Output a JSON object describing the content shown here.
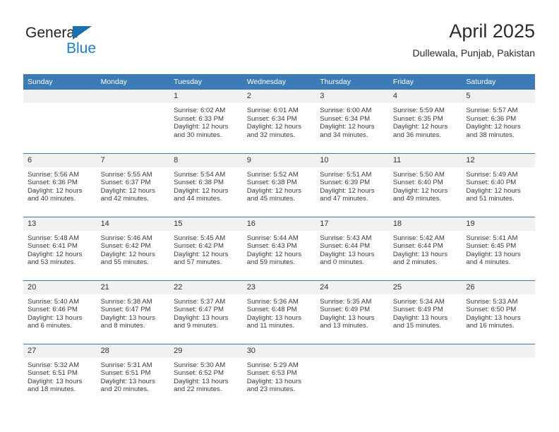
{
  "brand": {
    "name_part1": "General",
    "name_part2": "Blue",
    "accent_color": "#1a7fd4",
    "triangle_color": "#1a6fb5"
  },
  "header": {
    "title": "April 2025",
    "subtitle": "Dullewala, Punjab, Pakistan",
    "header_bg": "#3b7cb8"
  },
  "calendar": {
    "weekday_headers": [
      "Sunday",
      "Monday",
      "Tuesday",
      "Wednesday",
      "Thursday",
      "Friday",
      "Saturday"
    ],
    "weeks": [
      [
        {
          "day": "",
          "lines": []
        },
        {
          "day": "",
          "lines": []
        },
        {
          "day": "1",
          "lines": [
            "Sunrise: 6:02 AM",
            "Sunset: 6:33 PM",
            "Daylight: 12 hours",
            "and 30 minutes."
          ]
        },
        {
          "day": "2",
          "lines": [
            "Sunrise: 6:01 AM",
            "Sunset: 6:34 PM",
            "Daylight: 12 hours",
            "and 32 minutes."
          ]
        },
        {
          "day": "3",
          "lines": [
            "Sunrise: 6:00 AM",
            "Sunset: 6:34 PM",
            "Daylight: 12 hours",
            "and 34 minutes."
          ]
        },
        {
          "day": "4",
          "lines": [
            "Sunrise: 5:59 AM",
            "Sunset: 6:35 PM",
            "Daylight: 12 hours",
            "and 36 minutes."
          ]
        },
        {
          "day": "5",
          "lines": [
            "Sunrise: 5:57 AM",
            "Sunset: 6:36 PM",
            "Daylight: 12 hours",
            "and 38 minutes."
          ]
        }
      ],
      [
        {
          "day": "6",
          "lines": [
            "Sunrise: 5:56 AM",
            "Sunset: 6:36 PM",
            "Daylight: 12 hours",
            "and 40 minutes."
          ]
        },
        {
          "day": "7",
          "lines": [
            "Sunrise: 5:55 AM",
            "Sunset: 6:37 PM",
            "Daylight: 12 hours",
            "and 42 minutes."
          ]
        },
        {
          "day": "8",
          "lines": [
            "Sunrise: 5:54 AM",
            "Sunset: 6:38 PM",
            "Daylight: 12 hours",
            "and 44 minutes."
          ]
        },
        {
          "day": "9",
          "lines": [
            "Sunrise: 5:52 AM",
            "Sunset: 6:38 PM",
            "Daylight: 12 hours",
            "and 45 minutes."
          ]
        },
        {
          "day": "10",
          "lines": [
            "Sunrise: 5:51 AM",
            "Sunset: 6:39 PM",
            "Daylight: 12 hours",
            "and 47 minutes."
          ]
        },
        {
          "day": "11",
          "lines": [
            "Sunrise: 5:50 AM",
            "Sunset: 6:40 PM",
            "Daylight: 12 hours",
            "and 49 minutes."
          ]
        },
        {
          "day": "12",
          "lines": [
            "Sunrise: 5:49 AM",
            "Sunset: 6:40 PM",
            "Daylight: 12 hours",
            "and 51 minutes."
          ]
        }
      ],
      [
        {
          "day": "13",
          "lines": [
            "Sunrise: 5:48 AM",
            "Sunset: 6:41 PM",
            "Daylight: 12 hours",
            "and 53 minutes."
          ]
        },
        {
          "day": "14",
          "lines": [
            "Sunrise: 5:46 AM",
            "Sunset: 6:42 PM",
            "Daylight: 12 hours",
            "and 55 minutes."
          ]
        },
        {
          "day": "15",
          "lines": [
            "Sunrise: 5:45 AM",
            "Sunset: 6:42 PM",
            "Daylight: 12 hours",
            "and 57 minutes."
          ]
        },
        {
          "day": "16",
          "lines": [
            "Sunrise: 5:44 AM",
            "Sunset: 6:43 PM",
            "Daylight: 12 hours",
            "and 59 minutes."
          ]
        },
        {
          "day": "17",
          "lines": [
            "Sunrise: 5:43 AM",
            "Sunset: 6:44 PM",
            "Daylight: 13 hours",
            "and 0 minutes."
          ]
        },
        {
          "day": "18",
          "lines": [
            "Sunrise: 5:42 AM",
            "Sunset: 6:44 PM",
            "Daylight: 13 hours",
            "and 2 minutes."
          ]
        },
        {
          "day": "19",
          "lines": [
            "Sunrise: 5:41 AM",
            "Sunset: 6:45 PM",
            "Daylight: 13 hours",
            "and 4 minutes."
          ]
        }
      ],
      [
        {
          "day": "20",
          "lines": [
            "Sunrise: 5:40 AM",
            "Sunset: 6:46 PM",
            "Daylight: 13 hours",
            "and 6 minutes."
          ]
        },
        {
          "day": "21",
          "lines": [
            "Sunrise: 5:38 AM",
            "Sunset: 6:47 PM",
            "Daylight: 13 hours",
            "and 8 minutes."
          ]
        },
        {
          "day": "22",
          "lines": [
            "Sunrise: 5:37 AM",
            "Sunset: 6:47 PM",
            "Daylight: 13 hours",
            "and 9 minutes."
          ]
        },
        {
          "day": "23",
          "lines": [
            "Sunrise: 5:36 AM",
            "Sunset: 6:48 PM",
            "Daylight: 13 hours",
            "and 11 minutes."
          ]
        },
        {
          "day": "24",
          "lines": [
            "Sunrise: 5:35 AM",
            "Sunset: 6:49 PM",
            "Daylight: 13 hours",
            "and 13 minutes."
          ]
        },
        {
          "day": "25",
          "lines": [
            "Sunrise: 5:34 AM",
            "Sunset: 6:49 PM",
            "Daylight: 13 hours",
            "and 15 minutes."
          ]
        },
        {
          "day": "26",
          "lines": [
            "Sunrise: 5:33 AM",
            "Sunset: 6:50 PM",
            "Daylight: 13 hours",
            "and 16 minutes."
          ]
        }
      ],
      [
        {
          "day": "27",
          "lines": [
            "Sunrise: 5:32 AM",
            "Sunset: 6:51 PM",
            "Daylight: 13 hours",
            "and 18 minutes."
          ]
        },
        {
          "day": "28",
          "lines": [
            "Sunrise: 5:31 AM",
            "Sunset: 6:51 PM",
            "Daylight: 13 hours",
            "and 20 minutes."
          ]
        },
        {
          "day": "29",
          "lines": [
            "Sunrise: 5:30 AM",
            "Sunset: 6:52 PM",
            "Daylight: 13 hours",
            "and 22 minutes."
          ]
        },
        {
          "day": "30",
          "lines": [
            "Sunrise: 5:29 AM",
            "Sunset: 6:53 PM",
            "Daylight: 13 hours",
            "and 23 minutes."
          ]
        },
        {
          "day": "",
          "lines": []
        },
        {
          "day": "",
          "lines": []
        },
        {
          "day": "",
          "lines": []
        }
      ]
    ]
  }
}
